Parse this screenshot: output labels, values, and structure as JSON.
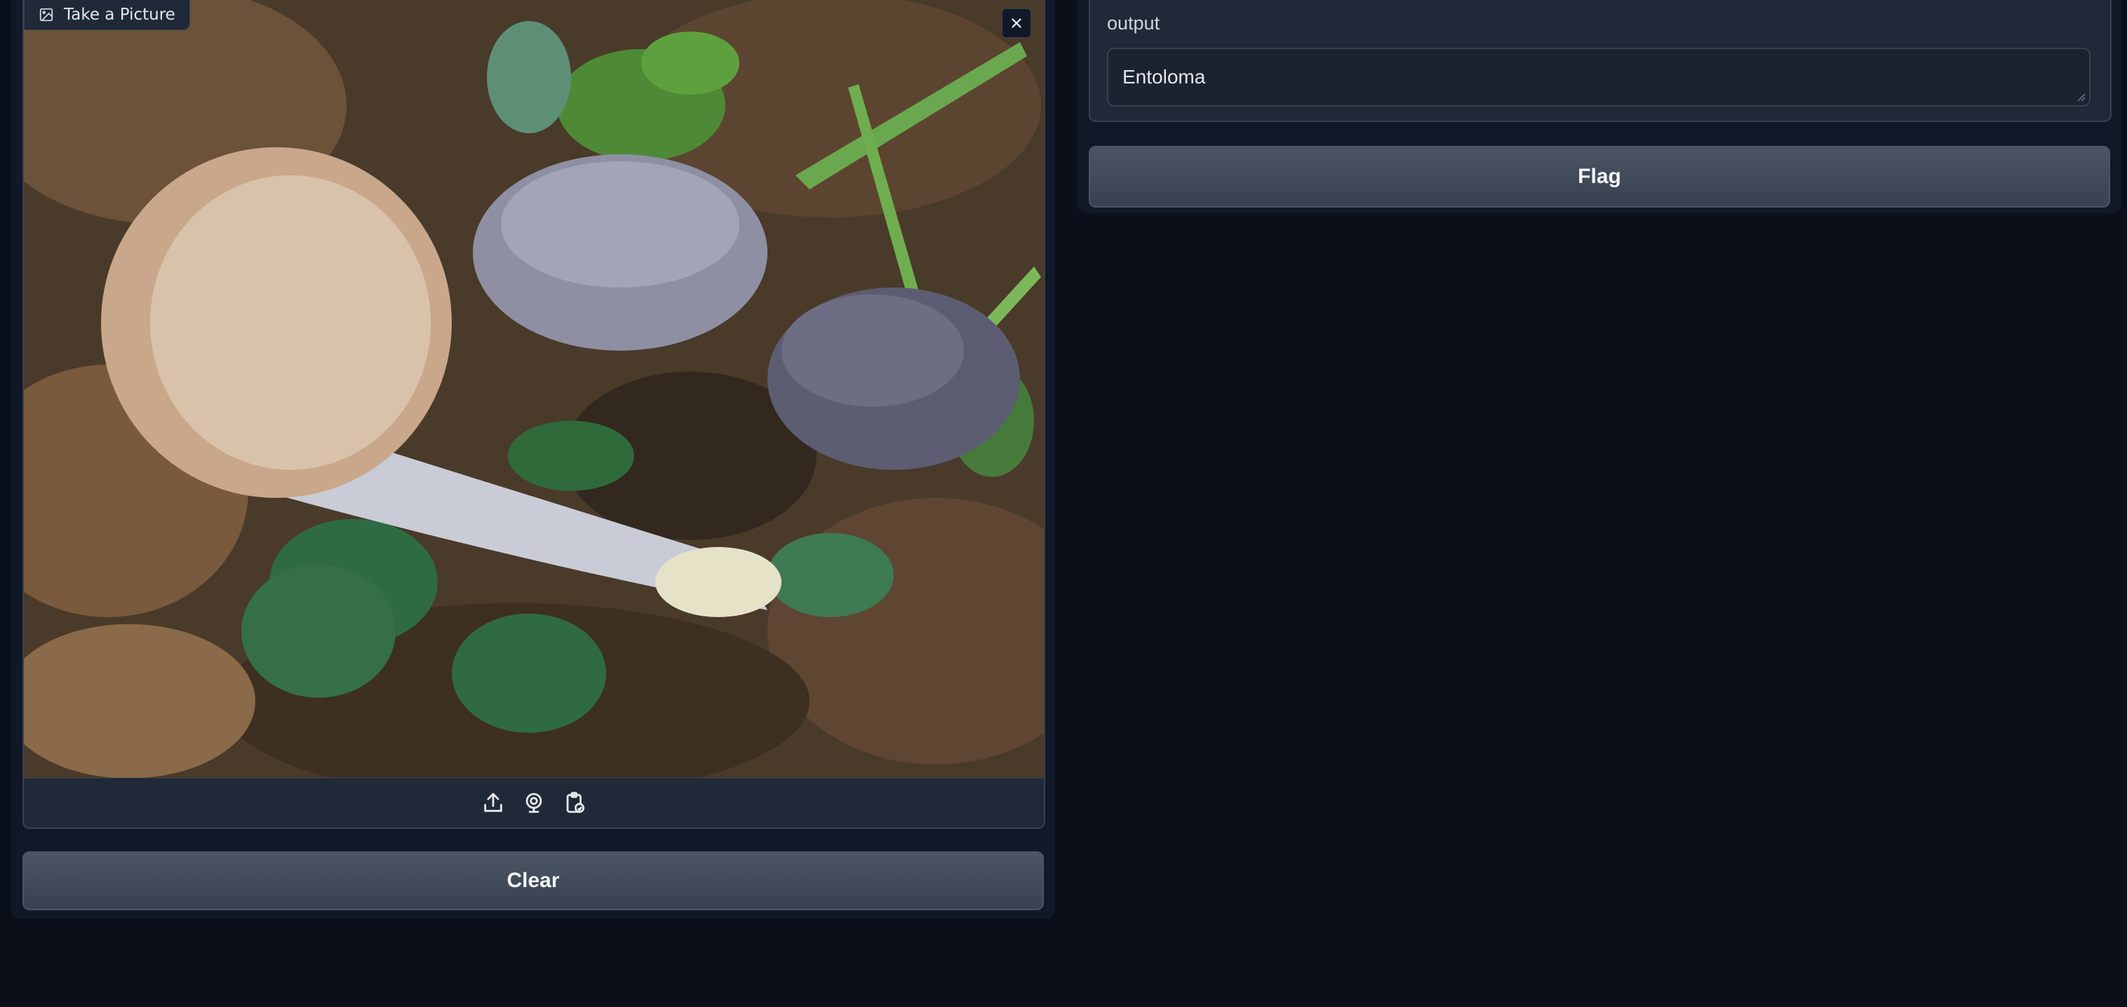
{
  "input": {
    "label": "Take a Picture",
    "image_alt": "Photo of grey-blue mushrooms on forest floor with leaves and green plants",
    "source_icons": [
      "upload-icon",
      "webcam-icon",
      "clipboard-icon"
    ],
    "close_icon": "close-icon"
  },
  "buttons": {
    "clear_label": "Clear",
    "flag_label": "Flag"
  },
  "output": {
    "label": "output",
    "value": "Entoloma"
  },
  "colors": {
    "background": "#0b0f19",
    "panel": "#111827",
    "block": "#1f2937",
    "border": "#374151",
    "button": "#4b5563"
  }
}
